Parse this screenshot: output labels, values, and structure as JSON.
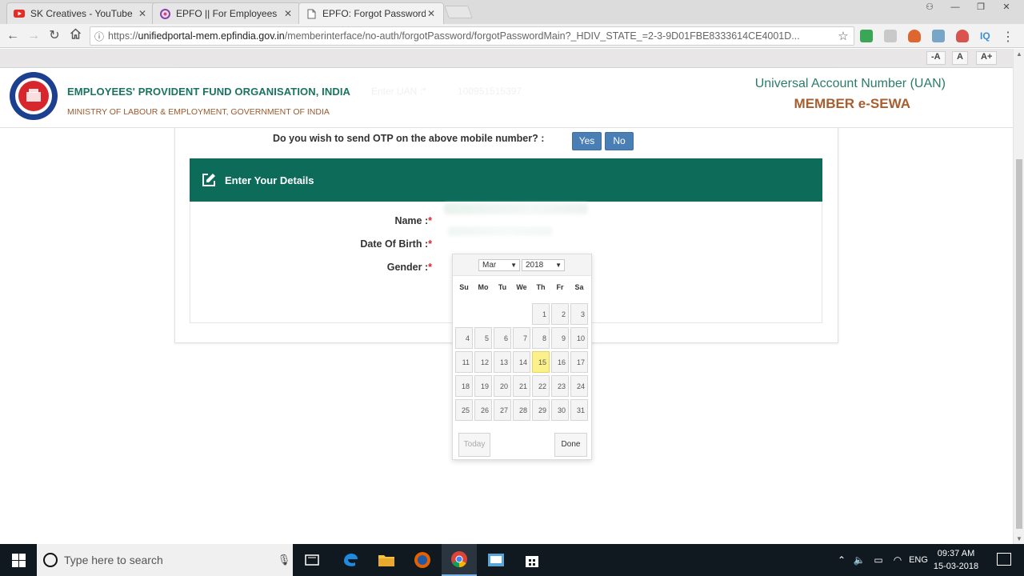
{
  "browser": {
    "tabs": [
      {
        "title": "SK Creatives - YouTube",
        "close": "✕"
      },
      {
        "title": "EPFO || For Employees",
        "close": "✕"
      },
      {
        "title": "EPFO: Forgot Password",
        "close": "✕"
      }
    ],
    "url_scheme": "https://",
    "url_host": "unifiedportal-mem.epfindia.gov.in",
    "url_path": "/memberinterface/no-auth/forgotPassword/forgotPasswordMain?_HDIV_STATE_=2-3-9D01FBE8333614CE4001D..."
  },
  "font_controls": {
    "decrease": "-A",
    "normal": "A",
    "increase": "A+"
  },
  "header": {
    "org_name": "EMPLOYEES' PROVIDENT FUND ORGANISATION, INDIA",
    "ministry": "MINISTRY OF LABOUR & EMPLOYMENT, GOVERNMENT OF INDIA",
    "uan_title": "Universal Account Number (UAN)",
    "esewa": "MEMBER e-SEWA",
    "hidden_uan_label": "Enter UAN :*",
    "hidden_uan_value": "100951515397"
  },
  "otp": {
    "question": "Do you wish to send OTP on the above mobile number? :",
    "yes": "Yes",
    "no": "No"
  },
  "details": {
    "heading": "Enter Your Details",
    "name_label": "Name :",
    "dob_label": "Date Of Birth :",
    "gender_label": "Gender :",
    "required_mark": "*"
  },
  "datepicker": {
    "month": "Mar",
    "year": "2018",
    "weekdays": [
      "Su",
      "Mo",
      "Tu",
      "We",
      "Th",
      "Fr",
      "Sa"
    ],
    "first_weekday_index": 4,
    "days_in_month": 31,
    "highlighted_day": 15,
    "today_label": "Today",
    "done_label": "Done"
  },
  "taskbar": {
    "search_placeholder": "Type here to search",
    "language": "ENG",
    "time": "09:37 AM",
    "date": "15-03-2018"
  },
  "colors": {
    "brand_green": "#0d6b5a",
    "button_blue": "#4a7fb5",
    "heading_orange": "#a85d2f",
    "today_yellow": "#fbf08a"
  }
}
